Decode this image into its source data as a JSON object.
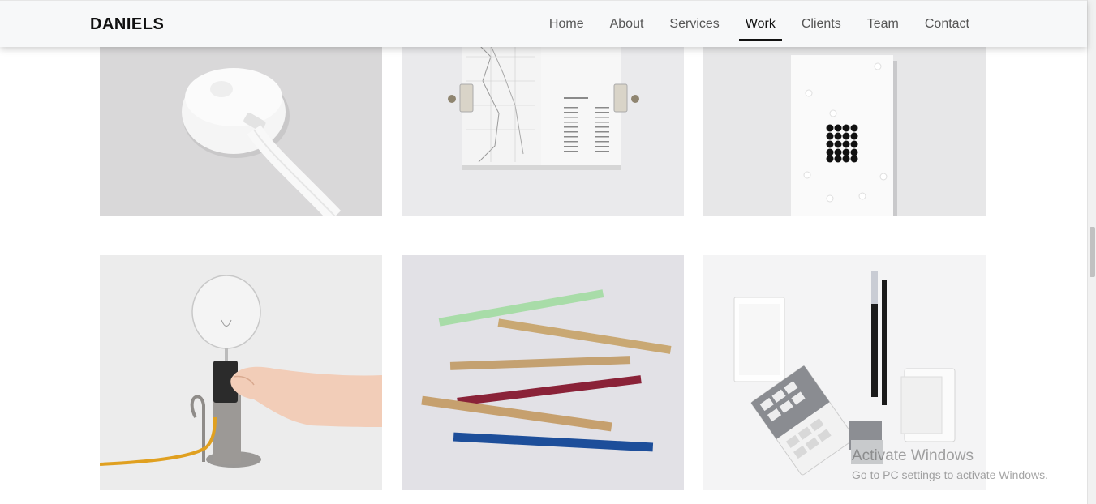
{
  "brand": "DANIELS",
  "nav": {
    "items": [
      {
        "label": "Home"
      },
      {
        "label": "About"
      },
      {
        "label": "Services"
      },
      {
        "label": "Work"
      },
      {
        "label": "Clients"
      },
      {
        "label": "Team"
      },
      {
        "label": "Contact"
      }
    ],
    "active": "Work"
  },
  "gallery": {
    "items": [
      {
        "subject": "apple-airtag-charger"
      },
      {
        "subject": "open-map-book"
      },
      {
        "subject": "white-dot-card"
      },
      {
        "subject": "hand-holding-lamp"
      },
      {
        "subject": "colored-rulers"
      },
      {
        "subject": "stationery-set"
      }
    ]
  },
  "watermark": {
    "title": "Activate Windows",
    "subtitle": "Go to PC settings to activate Windows."
  }
}
